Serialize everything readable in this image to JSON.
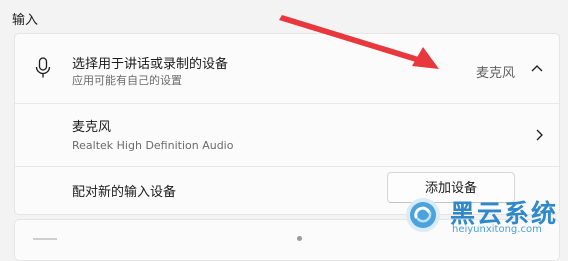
{
  "section": {
    "title": "输入"
  },
  "device_selector": {
    "title": "选择用于讲话或录制的设备",
    "subtitle": "应用可能有自己的设置",
    "current_value": "麦克风",
    "expanded": true,
    "icon": "microphone-icon"
  },
  "microphone_item": {
    "title": "麦克风",
    "subtitle": "Realtek High Definition Audio",
    "icon": "chevron-right-icon"
  },
  "pair_row": {
    "label": "配对新的输入设备",
    "button_label": "添加设备"
  },
  "annotation": {
    "arrow_color": "#e8383d"
  },
  "watermark": {
    "brand": "黑云系统",
    "url": "heiyunxitong.com",
    "color": "#2e88c9"
  }
}
